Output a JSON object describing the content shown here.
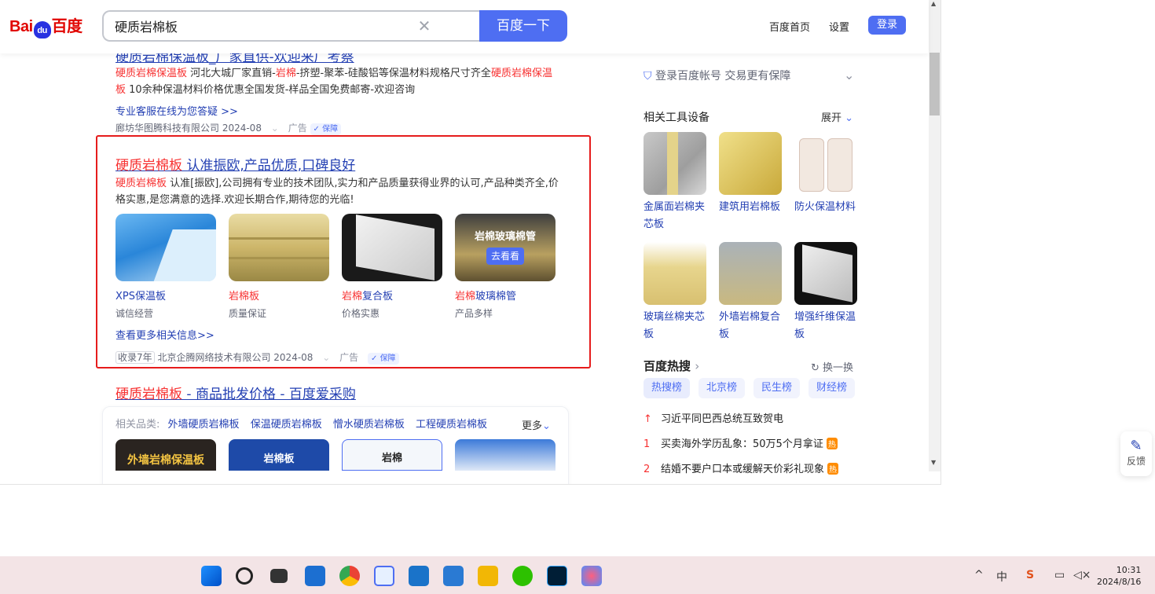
{
  "header": {
    "search_value": "硬质岩棉板",
    "search_button": "百度一下",
    "links": [
      "百度首页",
      "设置"
    ],
    "login": "登录",
    "logo_text_left": "Bai",
    "logo_text_mid": "du",
    "logo_text_right": "百度"
  },
  "result0": {
    "title_partial": "硬质岩棉保温板_厂家直供-欢迎来厂考察",
    "snippet_em1": "硬质岩棉保温板",
    "snippet_t1": " 河北大城厂家直销-",
    "snippet_em2": "岩棉",
    "snippet_t2": "-挤塑-聚苯-硅酸铝等保温材料规格尺寸齐全",
    "snippet_em3": "硬质岩棉保温板",
    "snippet_t3": " 10余种保温材料价格优惠全国发货-样品全国免费邮寄-欢迎咨询",
    "service_link": "专业客服在线为您答疑 >>",
    "source": "廊坊华图腾科技有限公司 2024-08",
    "ad": "广告",
    "guarantee": "保障"
  },
  "result1": {
    "title_em": "硬质岩棉板",
    "title_rest": " 认准振欧,产品优质,口碑良好",
    "snippet_em": "硬质岩棉板",
    "snippet_rest": " 认准[振欧],公司拥有专业的技术团队,实力和产品质量获得业界的认可,产品种类齐全,价格实惠,是您满意的选择.欢迎长期合作,期待您的光临!",
    "items": [
      {
        "label_em": "",
        "label": "XPS保温板",
        "sub": "诚信经营"
      },
      {
        "label_em": "岩棉板",
        "label": "",
        "sub": "质量保证"
      },
      {
        "label_em": "岩棉",
        "label": "复合板",
        "sub": "价格实惠"
      },
      {
        "label_em": "岩棉",
        "label": "玻璃棉管",
        "sub": "产品多样"
      }
    ],
    "overlay_title": "岩棉玻璃棉管",
    "overlay_btn": "去看看",
    "more_link": "查看更多相关信息>>",
    "collected": "收录7年",
    "source": "北京企腾网络技术有限公司 2024-08",
    "ad": "广告",
    "guarantee": "保障"
  },
  "result2": {
    "title_em": "硬质岩棉板",
    "title_rest": " - 商品批发价格 - 百度爱采购",
    "related_label": "相关品类:",
    "related": [
      "外墙硬质岩棉板",
      "保温硬质岩棉板",
      "憎水硬质岩棉板",
      "工程硬质岩棉板"
    ],
    "more": "更多",
    "cards": [
      "外墙岩棉保温板",
      "岩棉板",
      "岩棉",
      ""
    ]
  },
  "sidebar": {
    "account_text": "登录百度帐号 交易更有保障",
    "tools_title": "相关工具设备",
    "expand": "展开",
    "tools": [
      {
        "label": "金属面岩棉夹芯板"
      },
      {
        "label": "建筑用岩棉板"
      },
      {
        "label": "防火保温材料"
      },
      {
        "label": "玻璃丝棉夹芯板"
      },
      {
        "label": "外墙岩棉复合板"
      },
      {
        "label": "增强纤维保温板"
      }
    ],
    "hot_title": "百度热搜",
    "refresh": "换一换",
    "hot_tabs": [
      "热搜榜",
      "北京榜",
      "民生榜",
      "财经榜"
    ],
    "hot_items": [
      {
        "num": "↑",
        "text": "习近平同巴西总统互致贺电",
        "badge": ""
      },
      {
        "num": "1",
        "text": "买卖海外学历乱象：50万5个月拿证",
        "badge": "热"
      },
      {
        "num": "2",
        "text": "结婚不要户口本或缓解天价彩礼现象",
        "badge": "热"
      }
    ]
  },
  "feedback": "反馈",
  "clock": {
    "time": "10:31",
    "date": "2024/8/16"
  },
  "tray_icons": [
    "^",
    "中",
    "S"
  ]
}
